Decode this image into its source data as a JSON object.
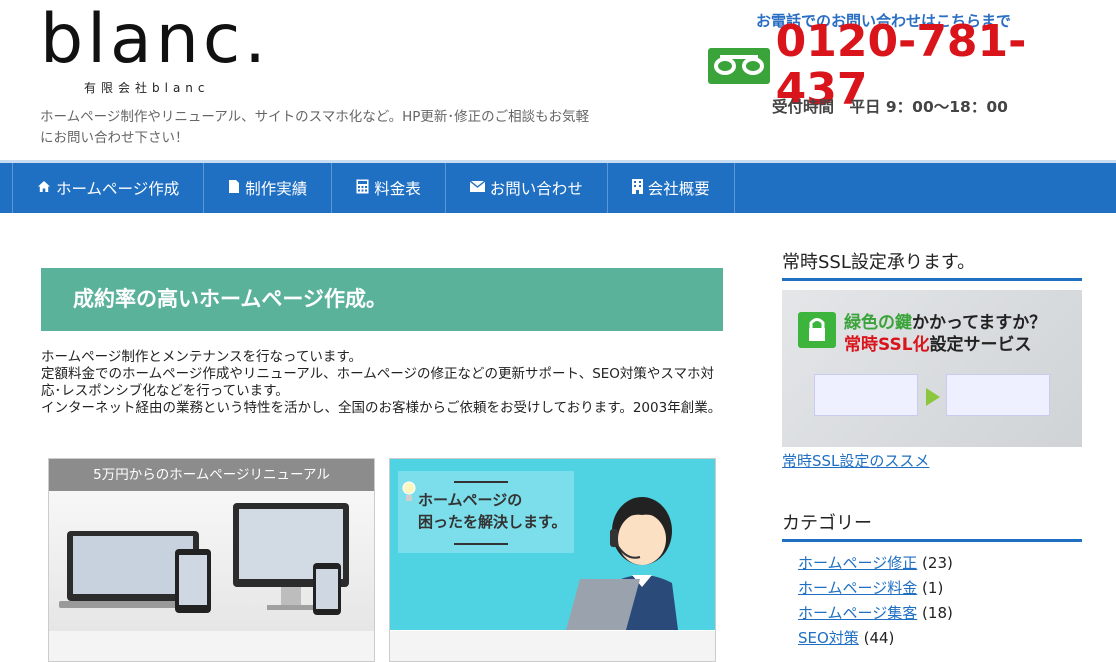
{
  "header": {
    "logo_text": "blanc.",
    "logo_subtext": "有限会社blanc",
    "tagline": "ホームページ制作やリニューアル、サイトのスマホ化など。HP更新･修正のご相談もお気軽にお問い合わせ下さい！",
    "contact_heading": "お電話でのお問い合わせはこちらまで",
    "phone": "0120-781-437",
    "hours": "受付時間　平日 9：00～18：00"
  },
  "nav": {
    "items": [
      {
        "label": "ホームページ作成",
        "icon": "home-icon"
      },
      {
        "label": "制作実績",
        "icon": "document-icon"
      },
      {
        "label": "料金表",
        "icon": "calculator-icon"
      },
      {
        "label": "お問い合わせ",
        "icon": "envelope-icon"
      },
      {
        "label": "会社概要",
        "icon": "building-icon"
      }
    ]
  },
  "main": {
    "headline": "成約率の高いホームページ作成。",
    "intro": [
      "ホームページ制作とメンテナンスを行なっています。",
      "定額料金でのホームページ作成やリニューアル、ホームページの修正などの更新サポート、SEO対策やスマホ対応･レスポンシブ化などを行っています。",
      "インターネット経由の業務という特性を活かし、全国のお客様からご依頼をお受けしております。2003年創業。"
    ],
    "card1_title": "5万円からのホームページリニューアル",
    "card2_text_line1": "ホームページの",
    "card2_text_line2": "困ったを解決します。"
  },
  "sidebar": {
    "ssl_title": "常時SSL設定承ります。",
    "ssl_banner_line1a": "緑色の鍵",
    "ssl_banner_line1b": "かかってますか？",
    "ssl_banner_line2a": "常時SSL化",
    "ssl_banner_line2b": "設定サービス",
    "ssl_link": "常時SSL設定のススメ",
    "category_title": "カテゴリー",
    "categories": [
      {
        "name": "ホームページ修正",
        "count": "(23)"
      },
      {
        "name": "ホームページ料金",
        "count": "(1)"
      },
      {
        "name": "ホームページ集客",
        "count": "(18)"
      },
      {
        "name": "SEO対策",
        "count": "(44)"
      }
    ]
  },
  "colors": {
    "nav_bg": "#1f6fc3",
    "headline_bg": "#5ab29a",
    "phone": "#d9141b",
    "contact_heading": "#2b6fc4",
    "card2_bg": "#4fd3e3"
  }
}
